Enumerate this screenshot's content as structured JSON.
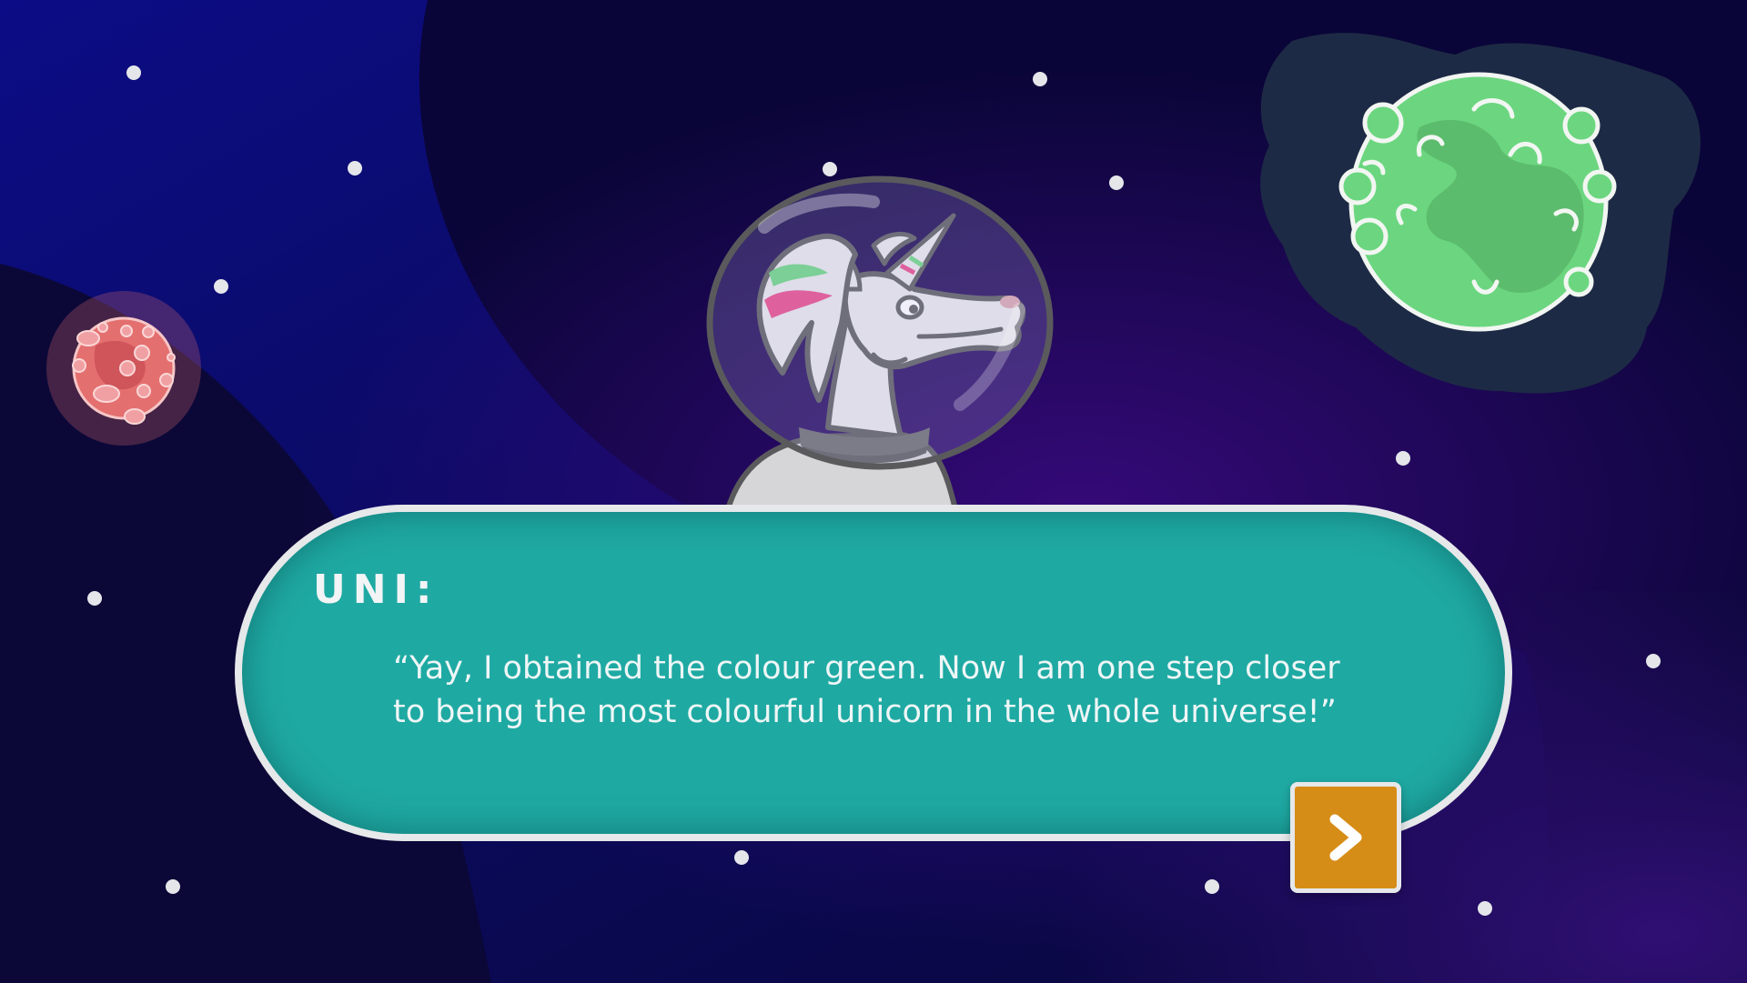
{
  "dialog": {
    "speaker": "UNI:",
    "text_line1": "“Yay, I obtained the colour green. Now I am one step closer",
    "text_line2": "to being the most colourful unicorn in the whole universe!”"
  },
  "controls": {
    "next_icon": "chevron-right-icon"
  },
  "colors": {
    "space_dark": "#0b0738",
    "space_blue": "#0c0d7c",
    "nebula_purple": "#3a0a7a",
    "dialog_teal": "#1fa9a3",
    "dialog_border": "#e6e8ea",
    "button_orange": "#d68d17",
    "green_planet": "#6bd67f",
    "red_planet": "#e06a6a"
  }
}
